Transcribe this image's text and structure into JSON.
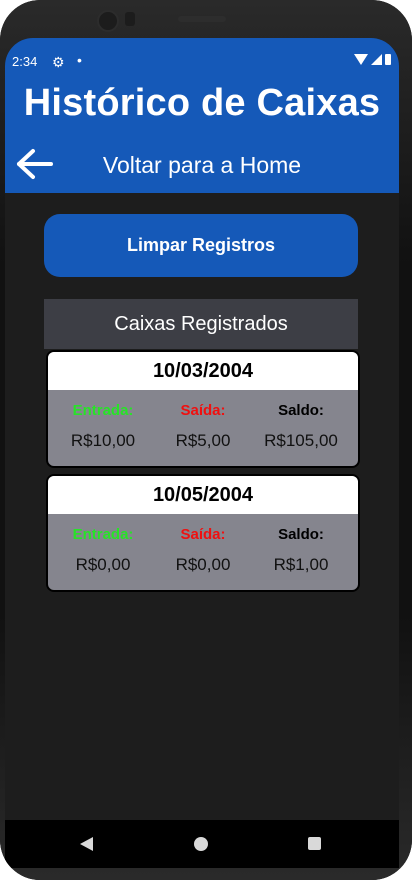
{
  "status": {
    "time": "2:34"
  },
  "header": {
    "title": "Histórico de Caixas",
    "back_label": "Voltar para a Home"
  },
  "actions": {
    "clear_label": "Limpar Registros"
  },
  "list": {
    "title": "Caixas Registrados",
    "records": [
      {
        "date": "10/03/2004",
        "entrada_label": "Entrada:",
        "saida_label": "Saída:",
        "saldo_label": "Saldo:",
        "entrada": "R$10,00",
        "saida": "R$5,00",
        "saldo": "R$105,00"
      },
      {
        "date": "10/05/2004",
        "entrada_label": "Entrada:",
        "saida_label": "Saída:",
        "saldo_label": "Saldo:",
        "entrada": "R$0,00",
        "saida": "R$0,00",
        "saldo": "R$1,00"
      }
    ]
  },
  "colors": {
    "primary": "#1559b8",
    "background": "#1d1d1d",
    "entrada": "#27e427",
    "saida": "#f01010",
    "card": "#85858e"
  },
  "icons": {
    "back": "arrow-left-icon",
    "settings": "gear-icon",
    "nav": [
      "nav-back-icon",
      "nav-home-icon",
      "nav-recent-icon"
    ]
  }
}
